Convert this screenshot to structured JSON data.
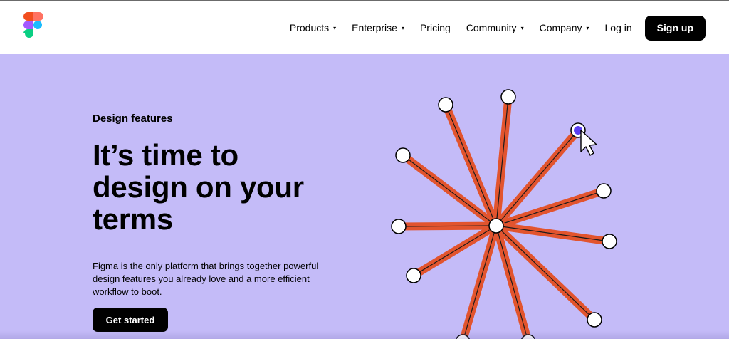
{
  "nav": {
    "items": [
      {
        "label": "Products",
        "caret": "▾"
      },
      {
        "label": "Enterprise",
        "caret": "▾"
      },
      {
        "label": "Pricing",
        "caret": ""
      },
      {
        "label": "Community",
        "caret": "▾"
      },
      {
        "label": "Company",
        "caret": "▾"
      }
    ],
    "login": "Log in",
    "signup": "Sign up"
  },
  "hero": {
    "eyebrow": "Design features",
    "headline": "It’s time to design on your terms",
    "description": "Figma is the only platform that brings together powerful design features you already love and a more efficient workflow to boot.",
    "cta": "Get started"
  },
  "colors": {
    "background": "#c4bbf8",
    "spoke": "#e2542e",
    "selected_handle": "#5b3ff2"
  },
  "icons": [
    "figma-logo-icon",
    "cursor-arrow-icon"
  ]
}
